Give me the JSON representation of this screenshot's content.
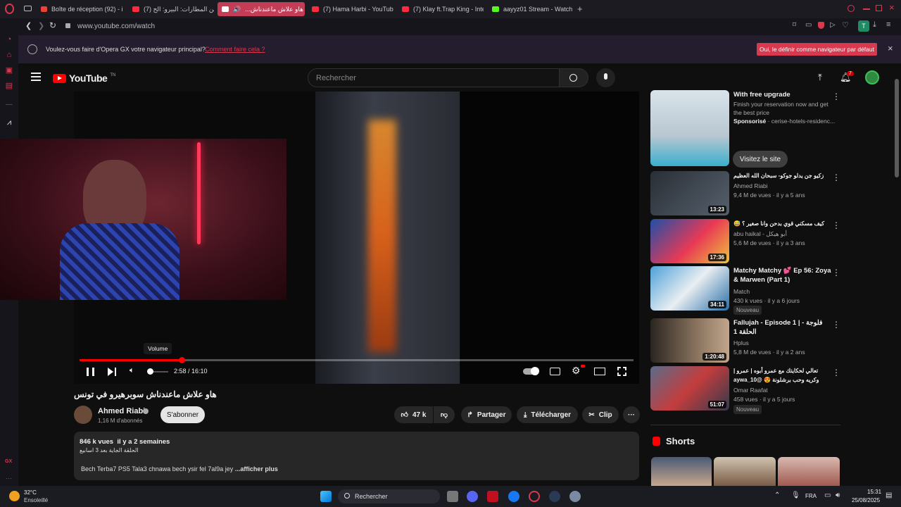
{
  "browser": {
    "tabs": [
      {
        "label": "Boîte de réception (92) - i"
      },
      {
        "label": "(7) أبن المطارات: البيرو: الح"
      },
      {
        "label": "(7) هاو علاش ماعندناش..."
      },
      {
        "label": "(7) Hama Harbi - YouTube"
      },
      {
        "label": "(7) Klay ft.Trap King - Inte"
      },
      {
        "label": "aayyz01 Stream - Watch l"
      }
    ],
    "new_tab": "+",
    "url": "www.youtube.com/watch",
    "infobar": {
      "message": "Voulez-vous faire d'Opera GX votre navigateur principal?",
      "link": "Comment faire cela ?",
      "button": "Oui, le définir comme navigateur par défaut",
      "close": "×"
    },
    "profile_initial": "T",
    "sidebar_label": "GX"
  },
  "youtube": {
    "logo": "YouTube",
    "logo_sup": "TN",
    "search_placeholder": "Rechercher",
    "notif_count": "7",
    "player": {
      "time": "2:58 / 16:10",
      "tooltip": "Volume",
      "progress": 0.184
    },
    "video": {
      "title": "هاو علاش ماعندناش سوبرهيرو في تونس",
      "channel": "Ahmed Riabi",
      "subs": "1,16 M d'abonnés",
      "subscribe": "S'abonner",
      "likes": "47 k",
      "share": "Partager",
      "download": "Télécharger",
      "clip": "Clip",
      "views_date": "846 k vues  il y a 2 semaines",
      "desc_ar": "الحلقة الجاية بعد 3 اسابيع",
      "desc": "Bech Terba7 PS5 Tala3 chnawa bech ysir fel 7al9a jey",
      "more": "...afficher plus"
    },
    "ad": {
      "title": "With free upgrade",
      "desc": "Finish your reservation now and get the best price",
      "sponsor": "Sponsorisé",
      "sponsor_site": "· cerise-hotels-residenc...",
      "cta": "Visitez le site"
    },
    "recs": [
      {
        "title": "زكيو جن يدلو جوكو- سبحان الله العظيم",
        "channel": "Ahmed Riabi",
        "meta": "9,4 M de vues · il y a 5 ans",
        "duration": "13:23",
        "badge": ""
      },
      {
        "title": "كيف مسكني قوي بدحن وانا صغير ؟ 😅",
        "channel": "abu haikal - أبو هيكل",
        "meta": "5,6 M de vues · il y a 3 ans",
        "duration": "17:36",
        "badge": ""
      },
      {
        "title": "Matchy Matchy 💕 Ep 56: Zoya & Marwen (Part 1)",
        "channel": "Match",
        "meta": "430 k vues · il y a 6 jours",
        "duration": "34:11",
        "badge": "Nouveau"
      },
      {
        "title": "Fallujah - Episode 1 | فلوجة - الحلقة 1",
        "channel": "Hplus",
        "meta": "5,8 M de vues · il y a 2 ans",
        "duration": "1:20:48",
        "badge": ""
      },
      {
        "title": "تعالي لحكايتك مع عمرو أبوه | عمرو | وكريه وحب برشلونة 😍 @aywa_10",
        "channel": "Omar Raafat",
        "meta": "458 vues · il y a 5 jours",
        "duration": "51:07",
        "badge": "Nouveau"
      }
    ],
    "shorts_label": "Shorts"
  },
  "taskbar": {
    "temp": "32°C",
    "weather": "Ensoleillé",
    "search": "Rechercher",
    "lang": "FRA",
    "time": "15:31",
    "date": "25/08/2025"
  }
}
